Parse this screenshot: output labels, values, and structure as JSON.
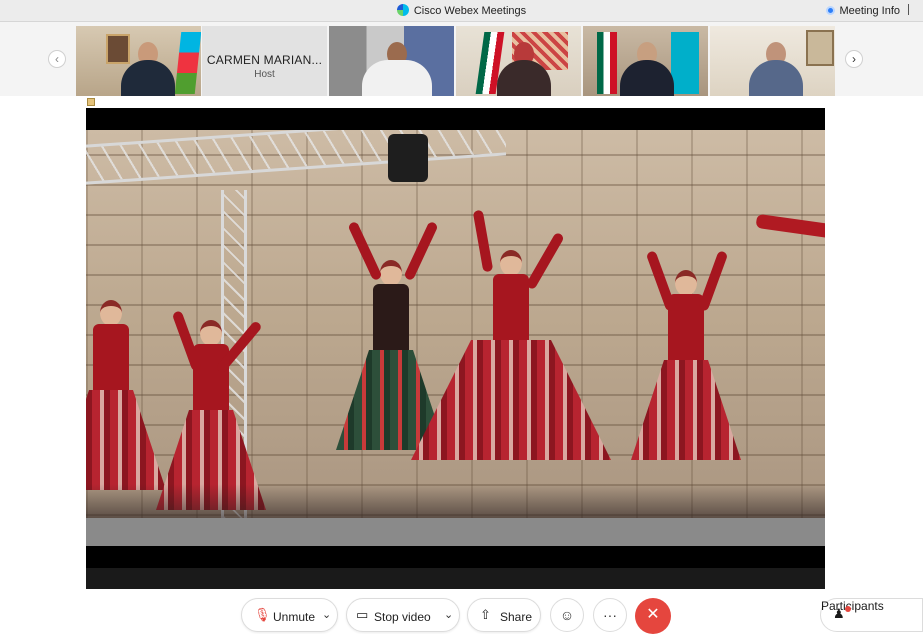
{
  "window": {
    "title": "Cisco Webex Meetings",
    "meeting_info_label": "Meeting Info"
  },
  "participants_strip": {
    "prev_icon": "chevron-left-icon",
    "next_icon": "chevron-right-icon",
    "host_tile": {
      "name": "CARMEN MARIAN...",
      "role": "Host"
    }
  },
  "controls": {
    "unmute_label": "Unmute",
    "stop_video_label": "Stop video",
    "share_label": "Share",
    "more_label": "···",
    "end_icon": "✕",
    "participants_label": "Participants"
  },
  "colors": {
    "end_button": "#e5463e",
    "accent": "#2d7ff9"
  }
}
